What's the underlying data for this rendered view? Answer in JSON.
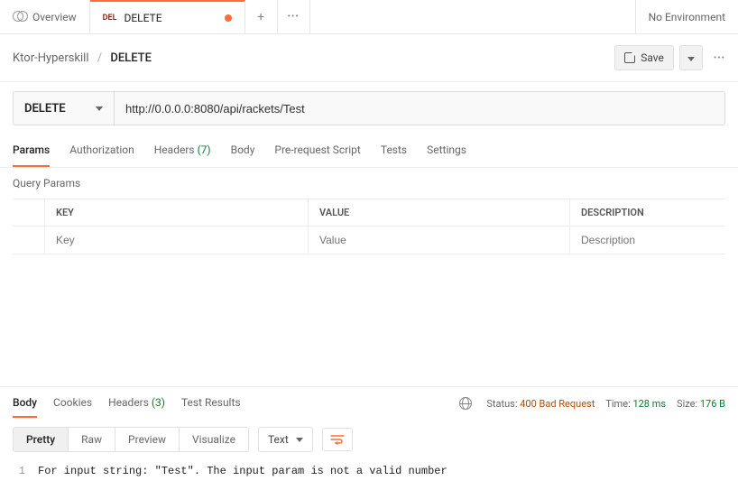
{
  "tabs": {
    "overview_label": "Overview",
    "active_method": "DEL",
    "active_label": "DELETE"
  },
  "env": {
    "label": "No Environment"
  },
  "breadcrumb": {
    "collection": "Ktor-Hyperskill",
    "request": "DELETE",
    "sep": "/"
  },
  "save": {
    "label": "Save"
  },
  "request": {
    "method": "DELETE",
    "url": "http://0.0.0.0:8080/api/rackets/Test"
  },
  "req_tabs": {
    "params": "Params",
    "auth": "Authorization",
    "headers": "Headers",
    "headers_count": "(7)",
    "body": "Body",
    "prerequest": "Pre-request Script",
    "tests": "Tests",
    "settings": "Settings"
  },
  "query_params": {
    "label": "Query Params",
    "col_key": "KEY",
    "col_value": "VALUE",
    "col_desc": "DESCRIPTION",
    "ph_key": "Key",
    "ph_value": "Value",
    "ph_desc": "Description"
  },
  "resp_tabs": {
    "body": "Body",
    "cookies": "Cookies",
    "headers": "Headers",
    "headers_count": "(3)",
    "tests": "Test Results"
  },
  "status": {
    "status_label": "Status:",
    "status_value": "400 Bad Request",
    "time_label": "Time:",
    "time_value": "128 ms",
    "size_label": "Size:",
    "size_value": "176 B"
  },
  "resp_toolbar": {
    "pretty": "Pretty",
    "raw": "Raw",
    "preview": "Preview",
    "visualize": "Visualize",
    "type": "Text"
  },
  "response_body": {
    "line_no": "1",
    "text": "For input string: \"Test\". The input param is not a valid number"
  }
}
